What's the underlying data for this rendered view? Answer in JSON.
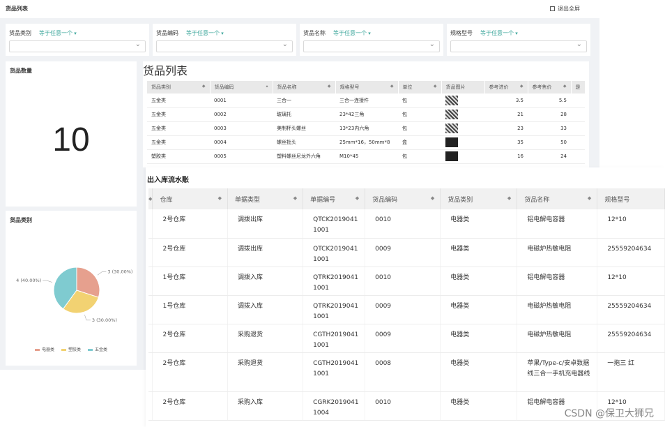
{
  "topbar": {
    "title": "货品列表",
    "exit_label": "退出全屏"
  },
  "filters": [
    {
      "label": "货品类别",
      "operator": "等于任意一个"
    },
    {
      "label": "货品编码",
      "operator": "等于任意一个"
    },
    {
      "label": "货品名称",
      "operator": "等于任意一个"
    },
    {
      "label": "规格型号",
      "operator": "等于任意一个"
    }
  ],
  "count_card": {
    "title": "货品数量",
    "value": "10"
  },
  "goods_table": {
    "title": "货品列表",
    "columns": [
      "货品类别",
      "货品编码",
      "货品名称",
      "规格型号",
      "单位",
      "货品图片",
      "参考进价",
      "参考售价",
      "是"
    ],
    "rows": [
      [
        "五金类",
        "0001",
        "三合一",
        "三合一连接件",
        "包",
        "",
        "3.5",
        "5.5"
      ],
      [
        "五金类",
        "0002",
        "玻璃托",
        "23*42三角",
        "包",
        "",
        "21",
        "28"
      ],
      [
        "五金类",
        "0003",
        "美制杯头螺丝",
        "13*23内六角",
        "包",
        "",
        "23",
        "33"
      ],
      [
        "五金类",
        "0004",
        "螺丝批头",
        "25mm*16，50mm*8",
        "盒",
        "",
        "35",
        "50"
      ],
      [
        "塑胶类",
        "0005",
        "塑料螺丝尼龙外六角",
        "M10*45",
        "包",
        "",
        "16",
        "24"
      ]
    ]
  },
  "pie_card": {
    "title": "货品类别",
    "slices": [
      {
        "name": "电器类",
        "value": 3,
        "label": "3 (30.00%)",
        "color": "#e6a08e"
      },
      {
        "name": "塑胶类",
        "value": 3,
        "label": "3 (30.00%)",
        "color": "#f2d272"
      },
      {
        "name": "五金类",
        "value": 4,
        "label": "4 (40.00%)",
        "color": "#7fcbd0"
      }
    ]
  },
  "ledger": {
    "title": "出入库流水账",
    "columns": [
      "仓库",
      "单据类型",
      "单据编号",
      "货品编码",
      "货品类别",
      "货品名称",
      "规格型号"
    ],
    "rows": [
      [
        "2号仓库",
        "调拨出库",
        "QTCK20190411001",
        "0010",
        "电器类",
        "铝电解电容器",
        "12*10"
      ],
      [
        "2号仓库",
        "调拨出库",
        "QTCK20190411001",
        "0009",
        "电器类",
        "电磁炉热敏电阻",
        "25559204634"
      ],
      [
        "1号仓库",
        "调拨入库",
        "QTRK20190411001",
        "0010",
        "电器类",
        "铝电解电容器",
        "12*10"
      ],
      [
        "1号仓库",
        "调拨入库",
        "QTRK20190411001",
        "0009",
        "电器类",
        "电磁炉热敏电阻",
        "25559204634"
      ],
      [
        "2号仓库",
        "采购退货",
        "CGTH20190411001",
        "0009",
        "电器类",
        "电磁炉热敏电阻",
        "25559204634"
      ],
      [
        "2号仓库",
        "采购退货",
        "CGTH20190411001",
        "0008",
        "电器类",
        "苹果/Type-c/安卓数据线三合一手机充电器线",
        "一拖三 红"
      ],
      [
        "2号仓库",
        "采购入库",
        "CGRK20190411004",
        "0010",
        "电器类",
        "铝电解电容器",
        "12*10"
      ]
    ]
  },
  "watermark": "CSDN @保卫大狮兄"
}
